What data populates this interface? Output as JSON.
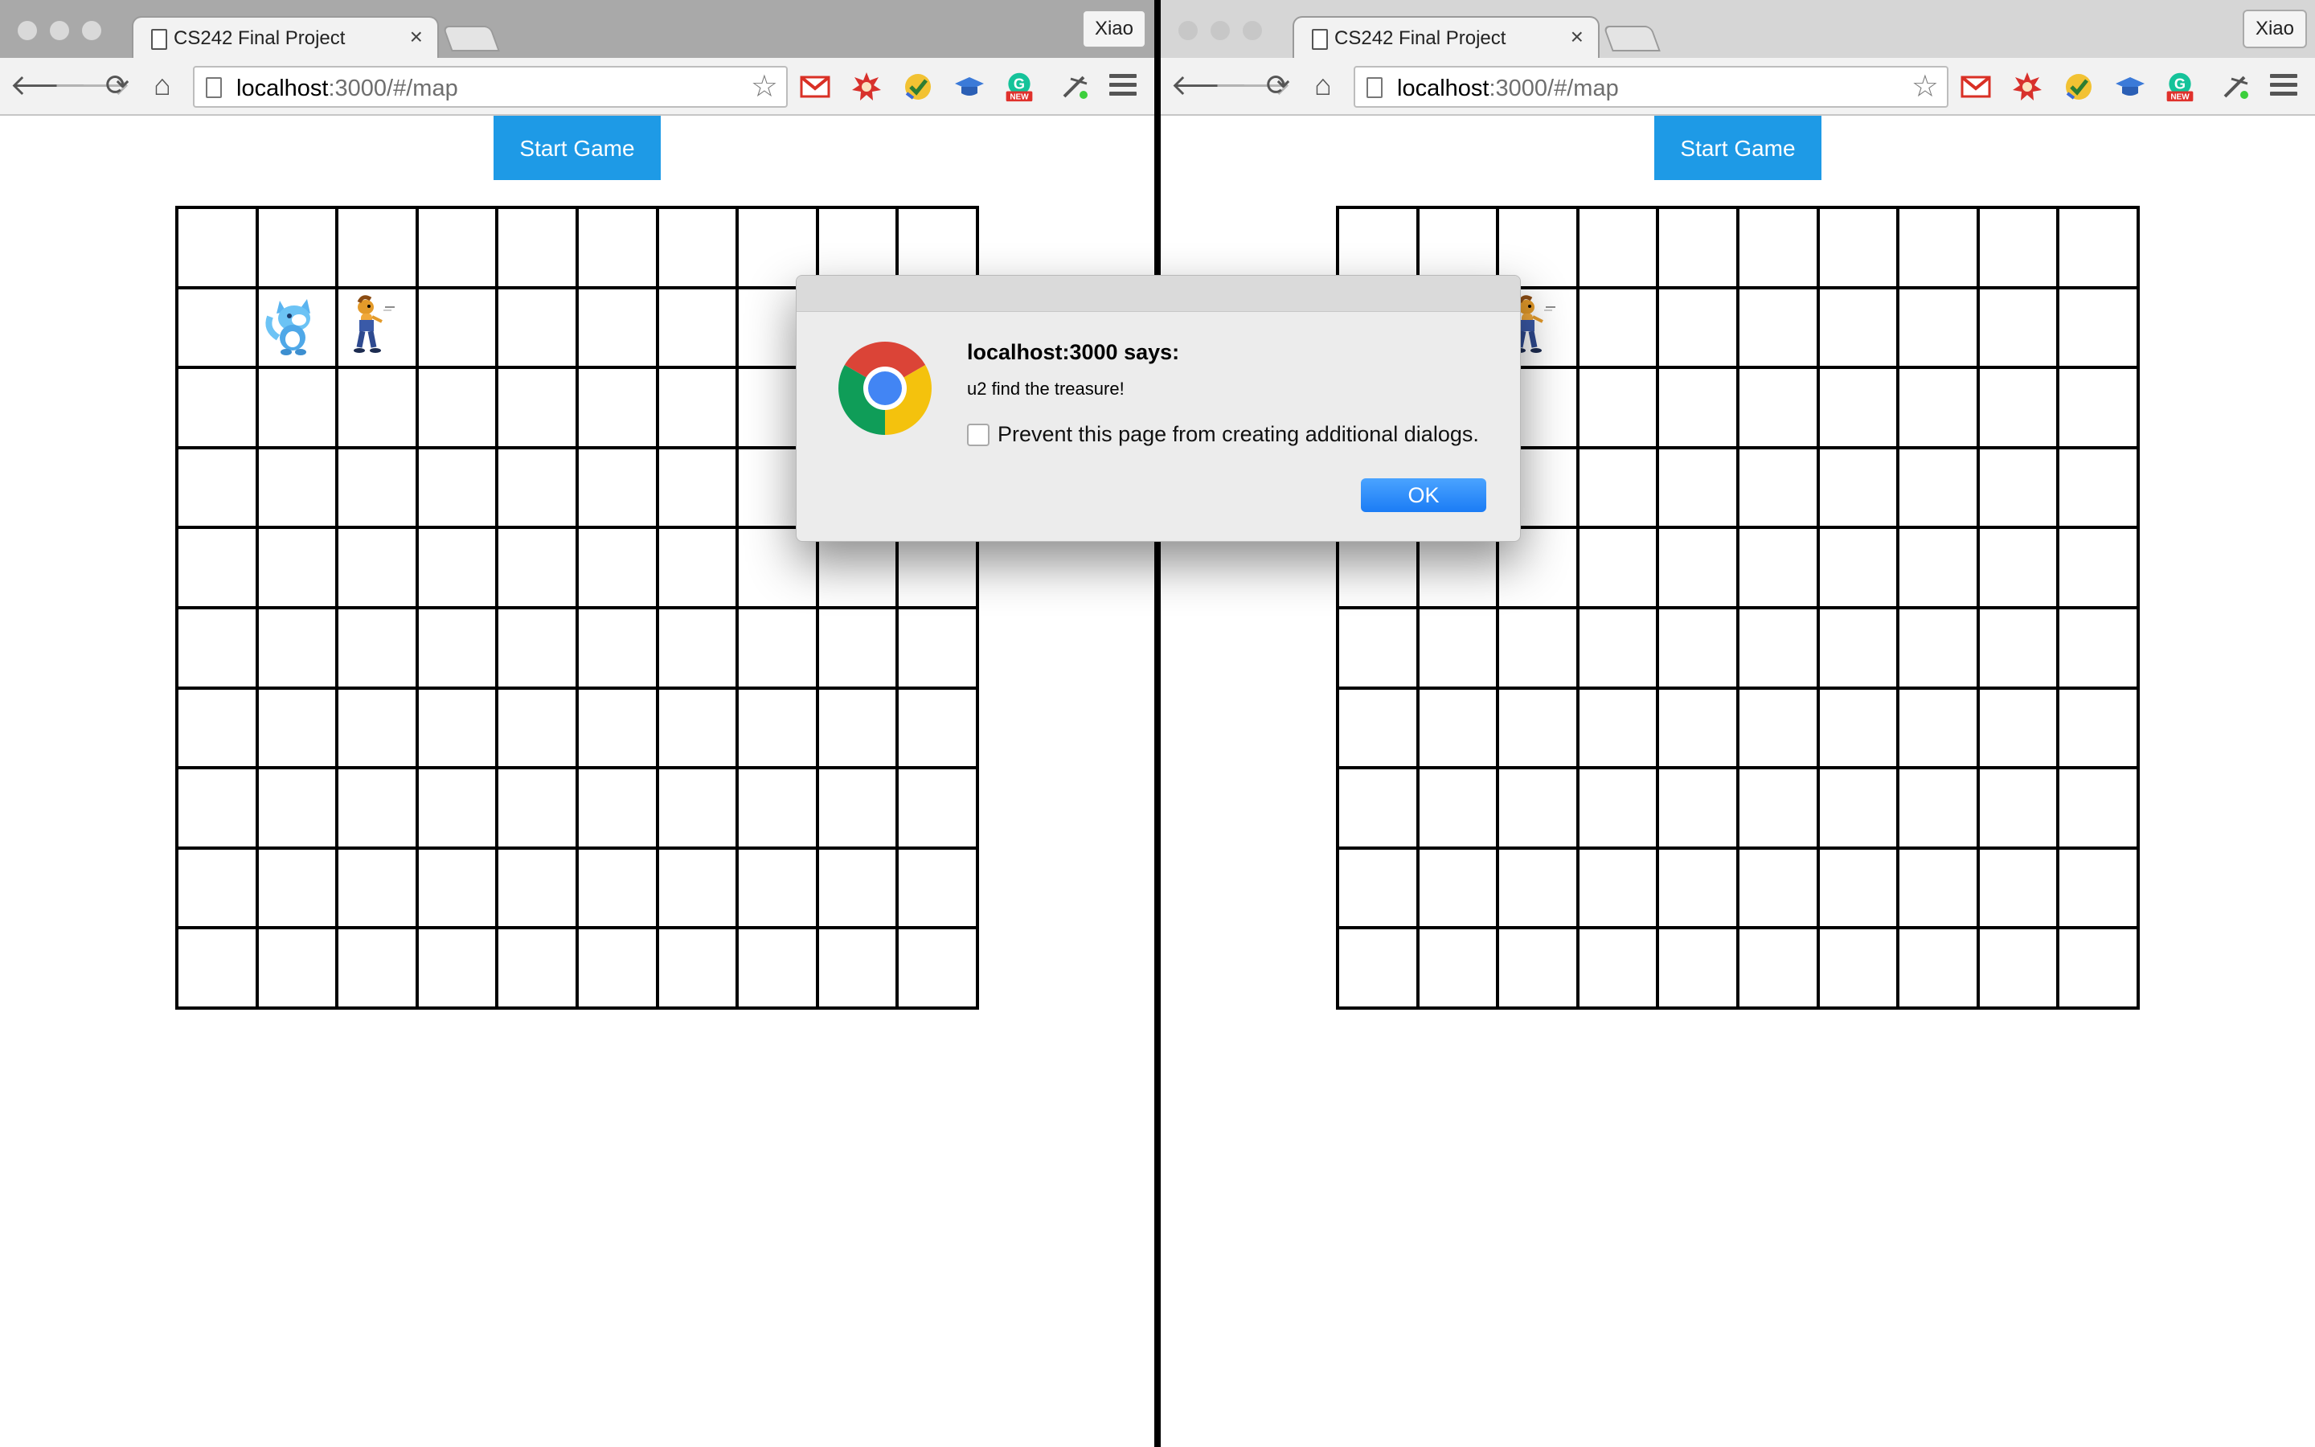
{
  "windows": [
    {
      "id": "left",
      "tab_title": "CS242 Final Project",
      "tab_close": "×",
      "profile": "Xiao",
      "url_host": "localhost",
      "url_path": ":3000/#/map",
      "start_button": "Start Game",
      "sprites": [
        {
          "row": 1,
          "col": 1,
          "name": "blue-fox-sprite"
        },
        {
          "row": 1,
          "col": 2,
          "name": "yellow-pony-sprite"
        }
      ]
    },
    {
      "id": "right",
      "tab_title": "CS242 Final Project",
      "tab_close": "×",
      "profile": "Xiao",
      "url_host": "localhost",
      "url_path": ":3000/#/map",
      "start_button": "Start Game",
      "sprites": [
        {
          "row": 1,
          "col": 2,
          "name": "yellow-pony-sprite"
        }
      ]
    }
  ],
  "board": {
    "rows": 10,
    "cols": 10
  },
  "dialog": {
    "title": "localhost:3000 says:",
    "message": "u2 find the treasure!",
    "checkbox_label": "Prevent this page from creating additional dialogs.",
    "checkbox_checked": false,
    "ok_label": "OK"
  },
  "icons": {
    "nav": [
      "back-arrow-icon",
      "forward-arrow-icon",
      "reload-icon",
      "home-icon"
    ],
    "extensions": [
      "gmail-icon",
      "burst-extension-icon",
      "checkmark-extension-icon",
      "graduation-cap-icon",
      "grammarly-new-icon",
      "tools-extension-icon"
    ],
    "new_badge": "NEW"
  },
  "colors": {
    "start_button": "#1e9ae6",
    "ok_button": "#1b7cf5",
    "divider": "#000000"
  }
}
